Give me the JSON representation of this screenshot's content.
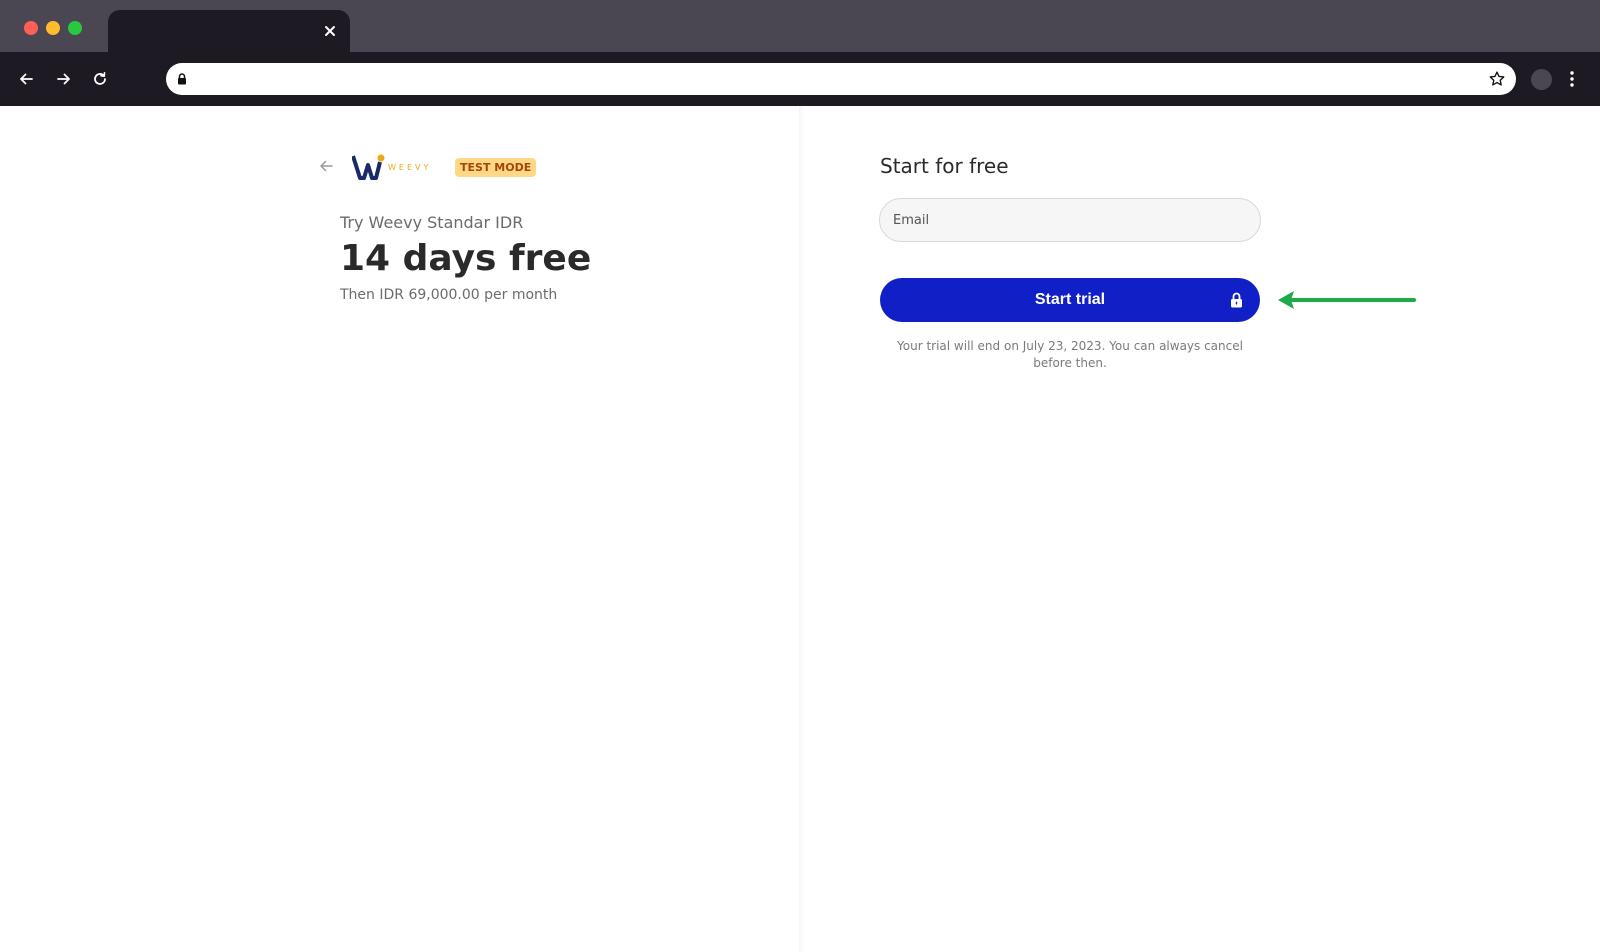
{
  "browser": {
    "tab_title": "",
    "url": "",
    "colors": {
      "tabstrip": "#4a4652",
      "toolbar": "#1e1a24"
    },
    "icons": [
      "close-icon",
      "back-arrow-icon",
      "forward-arrow-icon",
      "reload-icon",
      "lock-icon",
      "star-icon",
      "kebab-menu-icon"
    ]
  },
  "product": {
    "brand_logo_text": "WEEVY",
    "badge": "TEST MODE",
    "name": "Try Weevy Standar IDR",
    "headline": "14 days free",
    "then_price": "Then IDR 69,000.00 per month"
  },
  "form": {
    "title": "Start for free",
    "email_placeholder": "Email",
    "email_value": "",
    "submit_label": "Start trial",
    "note": "Your trial will end on July 23, 2023. You can always cancel before then."
  },
  "colors": {
    "primary_button": "#1120c6",
    "badge_bg": "#ffd886",
    "badge_text": "#a3470a",
    "annotation_arrow": "#1faa4a",
    "brand_navy": "#1b2a66",
    "brand_gold": "#e9a915"
  }
}
